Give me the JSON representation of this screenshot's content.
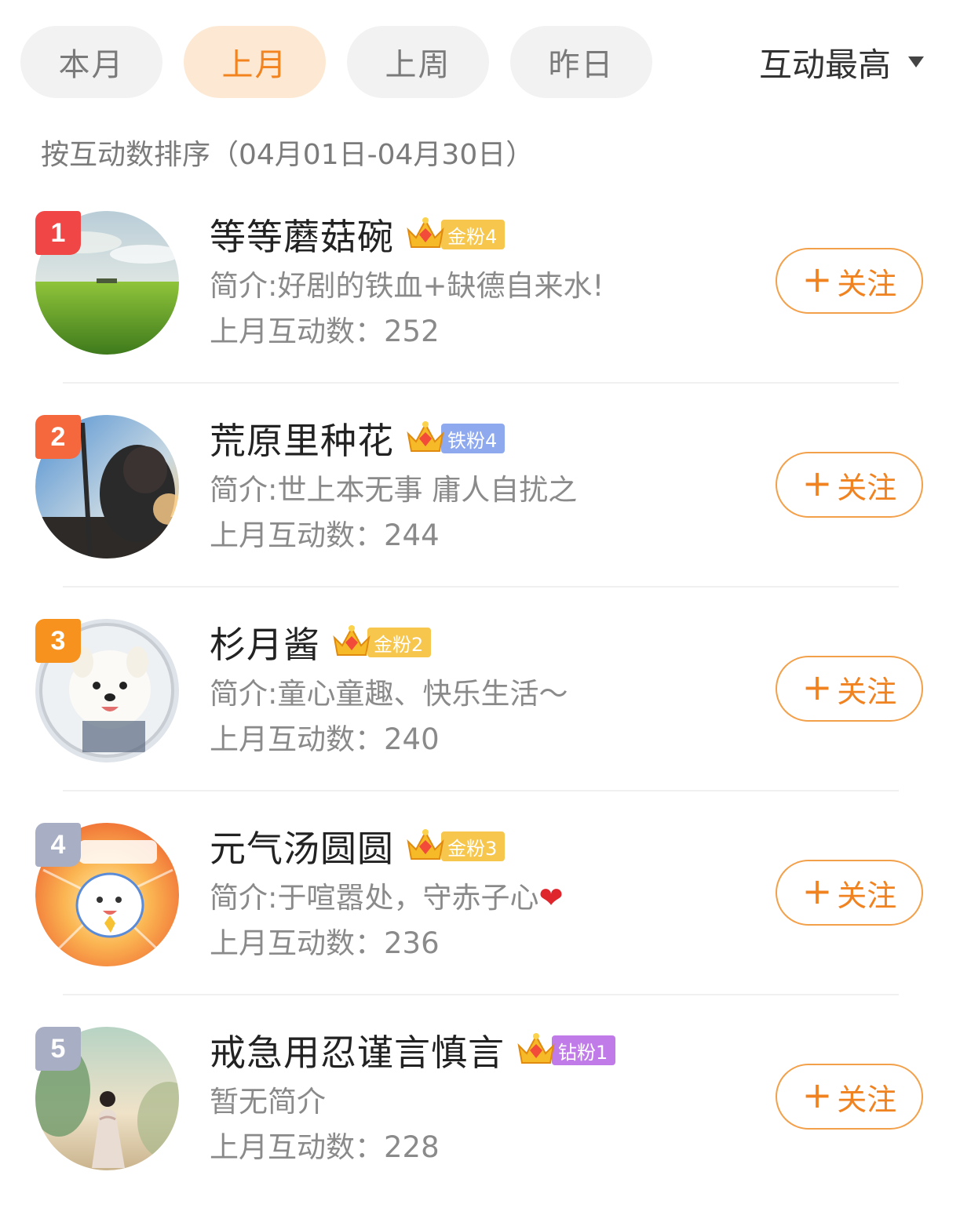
{
  "tabs": [
    {
      "label": "本月",
      "active": false
    },
    {
      "label": "上月",
      "active": true
    },
    {
      "label": "上周",
      "active": false
    },
    {
      "label": "昨日",
      "active": false
    }
  ],
  "sort": {
    "label": "互动最高",
    "icon": "caret-down-icon"
  },
  "subtitle": "按互动数排序（04月01日-04月30日）",
  "follow_label": "关注",
  "follow_icon": "+",
  "users": [
    {
      "rank": "1",
      "rank_color": "#f04646",
      "name": "等等蘑菇碗",
      "badge": "金粉4",
      "badge_level": "2",
      "badge_type": "gold",
      "bio": "简介:好剧的铁血+缺德自来水!",
      "count_label": "上月互动数：",
      "count": "252"
    },
    {
      "rank": "2",
      "rank_color": "#f5683e",
      "name": "荒原里种花",
      "badge": "铁粉4",
      "badge_level": "7",
      "badge_type": "iron",
      "bio": "简介:世上本无事 庸人自扰之",
      "count_label": "上月互动数：",
      "count": "244"
    },
    {
      "rank": "3",
      "rank_color": "#f7921f",
      "name": "杉月酱",
      "badge": "金粉2",
      "badge_level": "2",
      "badge_type": "gold",
      "bio": "简介:童心童趣、快乐生活～",
      "count_label": "上月互动数：",
      "count": "240"
    },
    {
      "rank": "4",
      "rank_color": "#a8aec4",
      "name": "元气汤圆圆",
      "badge": "金粉3",
      "badge_level": "5",
      "badge_type": "gold",
      "bio": "简介:于喧嚣处，守赤子心",
      "bio_emoji": "❤",
      "count_label": "上月互动数：",
      "count": "236"
    },
    {
      "rank": "5",
      "rank_color": "#a8aec4",
      "name": "戒急用忍谨言慎言",
      "badge": "钻粉1",
      "badge_level": "2",
      "badge_type": "diamond",
      "bio": "暂无简介",
      "count_label": "上月互动数：",
      "count": "228"
    }
  ],
  "colors": {
    "accent": "#f08220",
    "active_tab_bg": "#fde9d3",
    "tab_bg": "#f2f2f2"
  }
}
